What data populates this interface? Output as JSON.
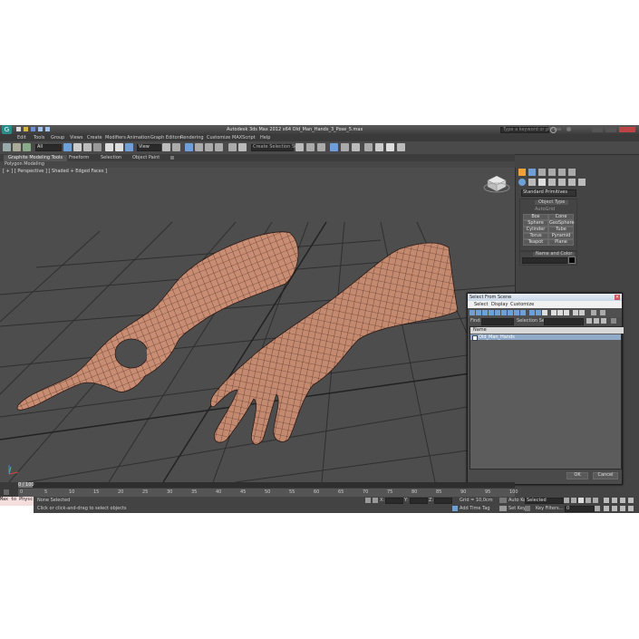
{
  "window": {
    "title": "Autodesk 3ds Max  2012 x64     Old_Man_Hands_3_Pose_5.max",
    "search_placeholder": "Type a keyword or phrase"
  },
  "menu": [
    "Edit",
    "Tools",
    "Group",
    "Views",
    "Create",
    "Modifiers",
    "Animation",
    "Graph Editors",
    "Rendering",
    "Customize",
    "MAXScript",
    "Help"
  ],
  "toolbar": {
    "filter_value": "All",
    "ref_coord_value": "View",
    "selection_set_placeholder": "Create Selection Se"
  },
  "ribbon": {
    "tabs": [
      "Graphite Modeling Tools",
      "Freeform",
      "Selection",
      "Object Paint"
    ],
    "sub_label": "Polygon Modeling"
  },
  "viewport": {
    "label": "[ + ] [ Perspective ] [ Shaded + Edged Faces ]"
  },
  "command_panel": {
    "category_value": "Standard Primitives",
    "rollout_object_type": "Object Type",
    "autogrid_label": "AutoGrid",
    "buttons": [
      "Box",
      "Cone",
      "Sphere",
      "GeoSphere",
      "Cylinder",
      "Tube",
      "Torus",
      "Pyramid",
      "Teapot",
      "Plane"
    ],
    "rollout_name_color": "Name and Color",
    "color_swatch": "#000000"
  },
  "dialog": {
    "title": "Select From Scene",
    "menu": [
      "Select",
      "Display",
      "Customize"
    ],
    "find_label": "Find:",
    "selection_set_label": "Selection Set:",
    "column_header": "Name",
    "items": [
      "Old_Man_Hands"
    ],
    "ok_label": "OK",
    "cancel_label": "Cancel"
  },
  "timeline": {
    "frame_readout": "0 / 100",
    "ticks": [
      "0",
      "5",
      "10",
      "15",
      "20",
      "25",
      "30",
      "35",
      "40",
      "45",
      "50",
      "55",
      "60",
      "65",
      "70",
      "75",
      "80",
      "85",
      "90",
      "95",
      "100"
    ]
  },
  "status": {
    "maxscript_text": "Max to Physc",
    "selection_status": "None Selected",
    "prompt": "Click or click-and-drag to select objects",
    "x_label": "X:",
    "y_label": "Y:",
    "z_label": "Z:",
    "grid": "Grid = 10,0cm",
    "add_time_tag": "Add Time Tag",
    "auto_key": "Auto Key",
    "auto_key_value": "Selected",
    "set_key": "Set Key",
    "key_filters": "Key Filters...",
    "frame_value": "0"
  },
  "colors": {
    "accent": "#f0a23a",
    "selected_row": "#8fa9c9",
    "viewport_bg": "#4d4d4d",
    "skin": "#c98d73"
  }
}
